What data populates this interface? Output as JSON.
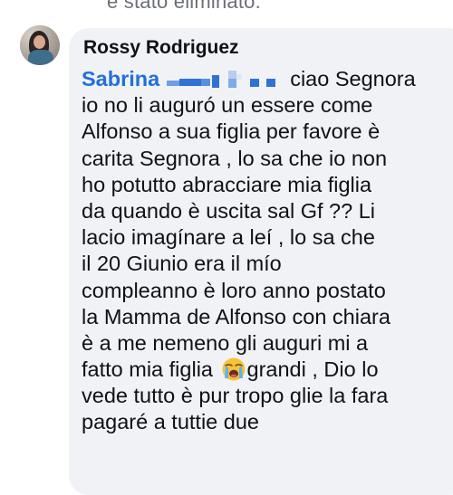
{
  "top_cut_text": "è stato eliminato.",
  "comment": {
    "author": "Rossy Rodriguez",
    "mention": "Sabrina",
    "lines": [
      "ciao Segnora",
      "io no li auguró un essere come",
      "Alfonso a sua figlia per favore è",
      "carita Segnora , lo sa che io non",
      "ho potutto abracciare mia figlia",
      "da quando è uscita sal Gf ?? Li",
      "lacio  imagínare  a leí , lo sa che",
      "il 20 Giunio era il mío",
      "compleanno è loro anno postato",
      "la Mamma de Alfonso con chiara",
      "è a me nemeno gli auguri mi a",
      "fatto mia  figlia",
      "grandi  , Dio lo",
      "vede tutto  è pur tropo glie la fara",
      "pagaré a tuttie due"
    ],
    "emoji": "loudly-crying-face-emoji",
    "colors": {
      "bubble": "#f0f2f5",
      "mention": "#216fdb",
      "text": "#101114",
      "redaction": "#2f72d6"
    }
  }
}
